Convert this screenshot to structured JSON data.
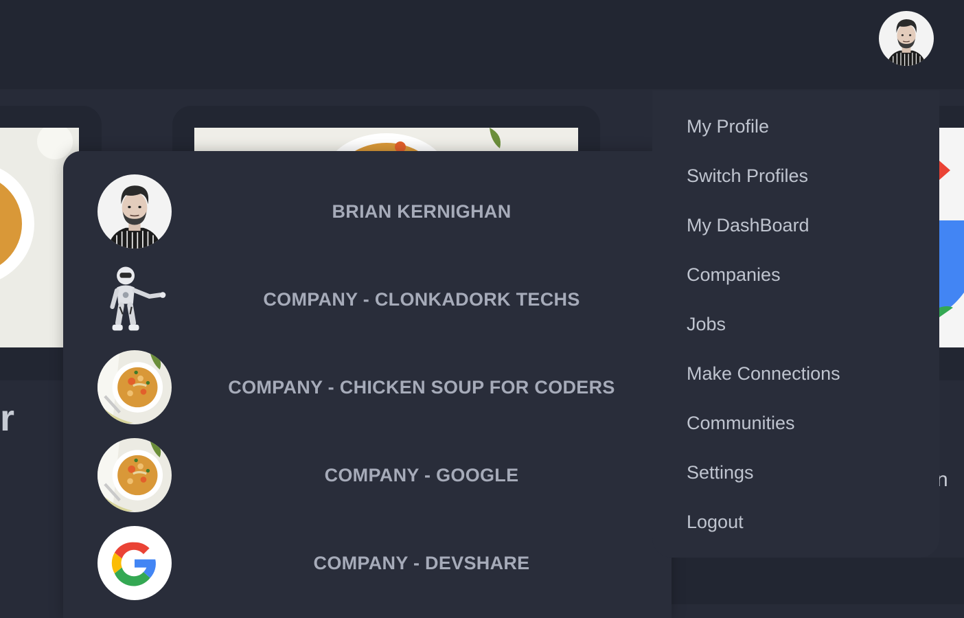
{
  "header": {
    "avatar_label": "User avatar"
  },
  "background": {
    "partial_heading": "r",
    "partial_text": "n"
  },
  "profile_switcher": {
    "profiles": [
      {
        "name": "BRIAN KERNIGHAN",
        "icon": "person-avatar"
      },
      {
        "name": "COMPANY - CLONKADORK TECHS",
        "icon": "robot-logo"
      },
      {
        "name": "COMPANY - CHICKEN SOUP FOR CODERS",
        "icon": "soup-logo"
      },
      {
        "name": "COMPANY - GOOGLE",
        "icon": "soup-logo"
      },
      {
        "name": "COMPANY - DEVSHARE",
        "icon": "google-g-logo"
      }
    ]
  },
  "user_menu": {
    "items": [
      {
        "label": "My Profile"
      },
      {
        "label": "Switch Profiles"
      },
      {
        "label": "My DashBoard"
      },
      {
        "label": "Companies"
      },
      {
        "label": "Jobs"
      },
      {
        "label": "Make Connections"
      },
      {
        "label": "Communities"
      },
      {
        "label": "Settings"
      },
      {
        "label": "Logout"
      }
    ]
  },
  "colors": {
    "page_bg": "#272b38",
    "header_bg": "#222632",
    "panel_bg": "#292d3a",
    "text_muted": "#a6abb9",
    "menu_text": "#bfc4cf"
  }
}
